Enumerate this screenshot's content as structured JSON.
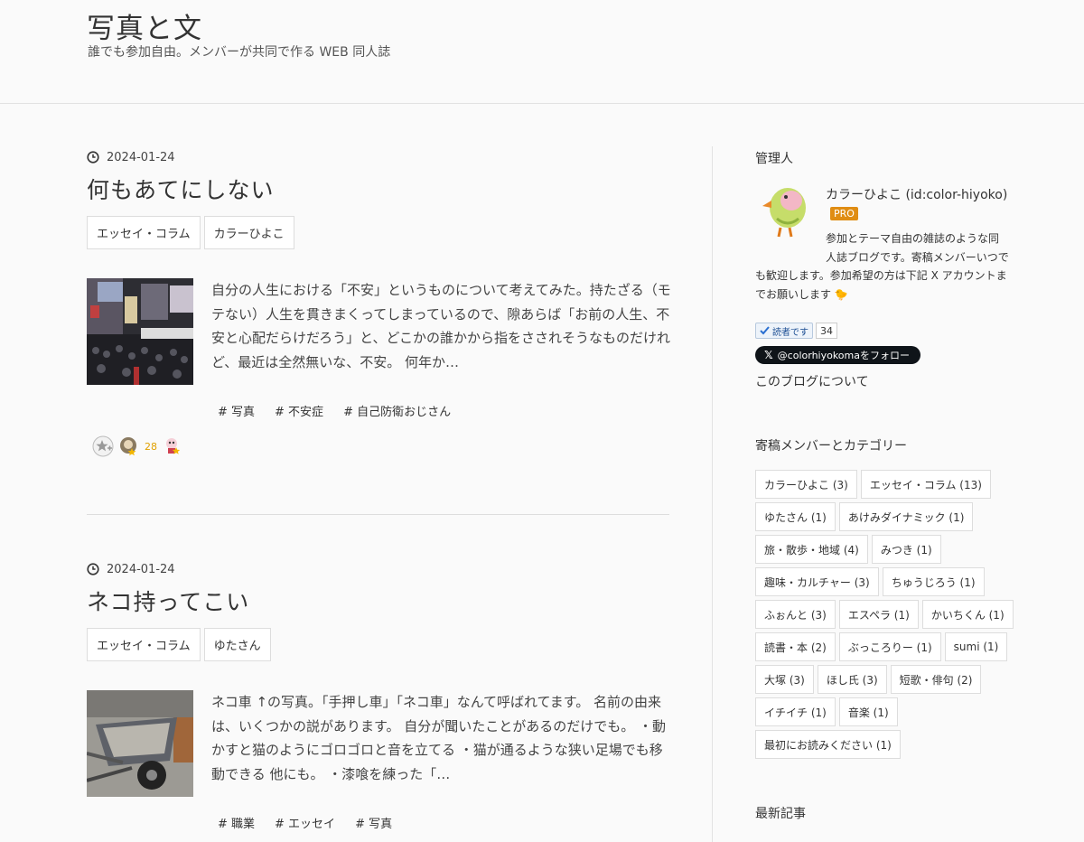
{
  "header": {
    "title": "写真と文",
    "description": "誰でも参加自由。メンバーが共同で作る WEB 同人誌"
  },
  "entries": [
    {
      "date": "2024-01-24",
      "title": "何もあてにしない",
      "categories": [
        "エッセイ・コラム",
        "カラーひよこ"
      ],
      "excerpt": "自分の人生における「不安」というものについて考えてみた。持たざる（モテない）人生を貫きまくってしまっているので、隙あらば「お前の人生、不安と心配だらけだろう」と、どこかの誰かから指をさされそうなものだけれど、最近は全然無いな、不安。 何年か…",
      "tags": [
        "# 写真",
        "# 不安症",
        "# 自己防衛おじさん"
      ],
      "star_count": "28"
    },
    {
      "date": "2024-01-24",
      "title": "ネコ持ってこい",
      "categories": [
        "エッセイ・コラム",
        "ゆたさん"
      ],
      "excerpt": "ネコ車 ↑の写真。「手押し車」「ネコ車」なんて呼ばれてます。 名前の由来は、いくつかの説があります。 自分が聞いたことがあるのだけでも。 ・動かすと猫のようにゴロゴロと音を立てる ・猫が通るような狭い足場でも移動できる 他にも。 ・漆喰を練った「…",
      "tags": [
        "# 職業",
        "# エッセイ",
        "# 写真"
      ]
    }
  ],
  "sidebar": {
    "admin_heading": "管理人",
    "author_name": "カラーひよこ (id:color-hiyoko)",
    "pro_badge": "PRO",
    "about": "参加とテーマ自由の雑誌のような同人誌ブログです。寄稿メンバーいつでも歓迎します。参加希望の方は下記 X アカウントまでお願いします 🐤",
    "reader_label": "読者です",
    "reader_count": "34",
    "x_follow": "@colorhiyokomaをフォロー",
    "about_link": "このブログについて",
    "categories_heading": "寄稿メンバーとカテゴリー",
    "categories": [
      "カラーひよこ (3)",
      "エッセイ・コラム (13)",
      "ゆたさん (1)",
      "あけみダイナミック (1)",
      "旅・散歩・地域 (4)",
      "みつき (1)",
      "趣味・カルチャー (3)",
      "ちゅうじろう (1)",
      "ふぉんと (3)",
      "エスペラ (1)",
      "かいちくん (1)",
      "読書・本 (2)",
      "ぶっころりー (1)",
      "sumi (1)",
      "大塚 (3)",
      "ほし氏 (3)",
      "短歌・俳句 (2)",
      "イチイチ (1)",
      "音楽 (1)",
      "最初にお読みください (1)"
    ],
    "recent_heading": "最新記事"
  }
}
